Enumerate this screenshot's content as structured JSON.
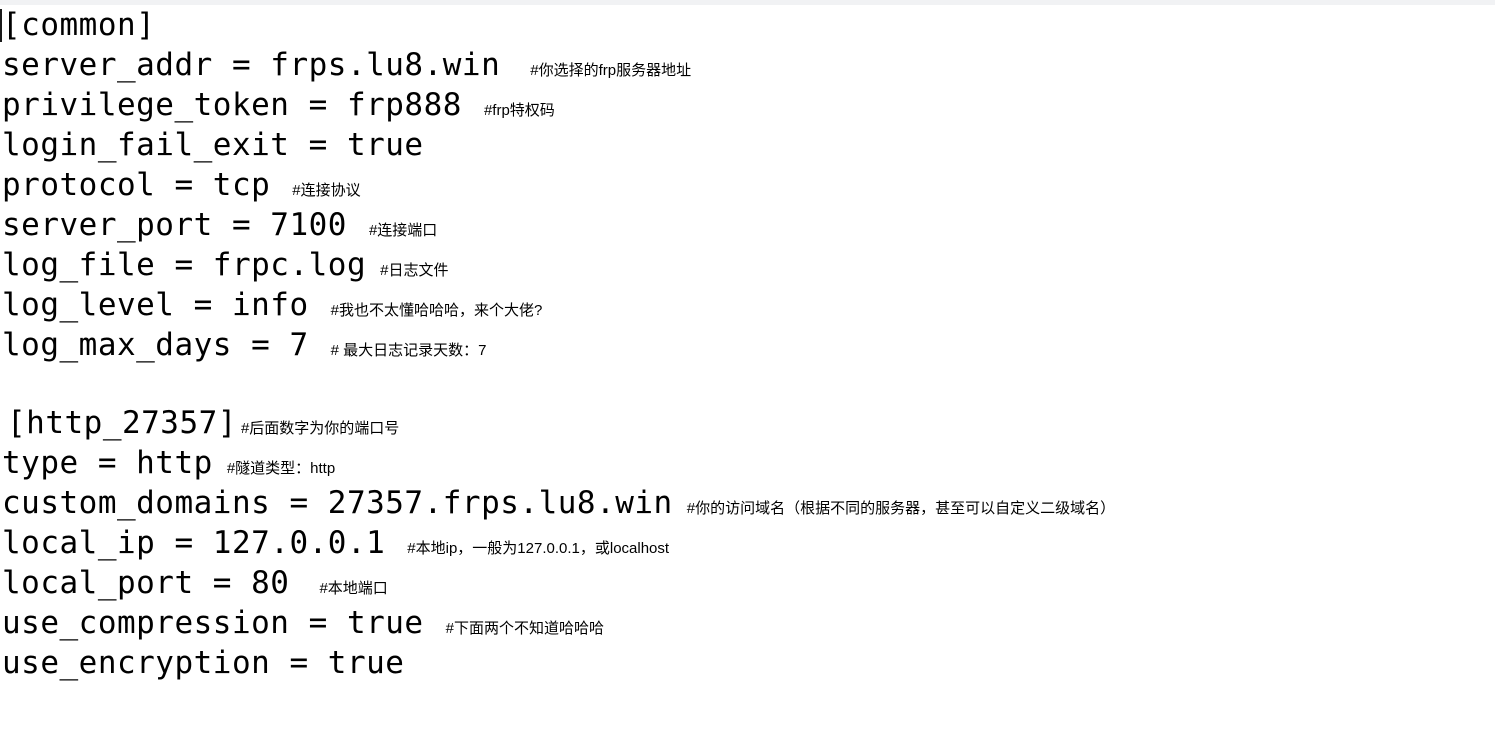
{
  "document": {
    "type": "ini-config",
    "background_color": "#ffffff",
    "text_color": "#000000",
    "top_strip_color": "#f1f2f4"
  },
  "lines": [
    {
      "id": "common-section",
      "code": "[common]",
      "comment": ""
    },
    {
      "id": "server-addr",
      "code": "server_addr = frps.lu8.win",
      "comment": "#你选择的frp服务器地址"
    },
    {
      "id": "privilege-token",
      "code": "privilege_token = frp888",
      "comment": "#frp特权码"
    },
    {
      "id": "login-fail-exit",
      "code": "login_fail_exit = true",
      "comment": ""
    },
    {
      "id": "protocol",
      "code": "protocol = tcp",
      "comment": "#连接协议"
    },
    {
      "id": "server-port",
      "code": "server_port = 7100",
      "comment": "#连接端口"
    },
    {
      "id": "log-file",
      "code": "log_file = frpc.log",
      "comment": "#日志文件"
    },
    {
      "id": "log-level",
      "code": "log_level = info",
      "comment": "#我也不太懂哈哈哈，来个大佬?"
    },
    {
      "id": "log-max-days",
      "code": "log_max_days = 7",
      "comment": "# 最大日志记录天数：7"
    },
    {
      "id": "blank-1",
      "code": "",
      "comment": ""
    },
    {
      "id": "http-section",
      "code": "[http_27357]",
      "comment": "#后面数字为你的端口号"
    },
    {
      "id": "type",
      "code": "type = http",
      "comment": "#隧道类型：http"
    },
    {
      "id": "custom-domains",
      "code": "custom_domains = 27357.frps.lu8.win",
      "comment": "#你的访问域名（根据不同的服务器，甚至可以自定义二级域名）"
    },
    {
      "id": "local-ip",
      "code": "local_ip = 127.0.0.1",
      "comment": "#本地ip，一般为127.0.0.1，或localhost"
    },
    {
      "id": "local-port",
      "code": "local_port = 80",
      "comment": "#本地端口"
    },
    {
      "id": "use-compression",
      "code": "use_compression = true",
      "comment": "#下面两个不知道哈哈哈"
    },
    {
      "id": "use-encryption",
      "code": "use_encryption = true",
      "comment": ""
    }
  ]
}
